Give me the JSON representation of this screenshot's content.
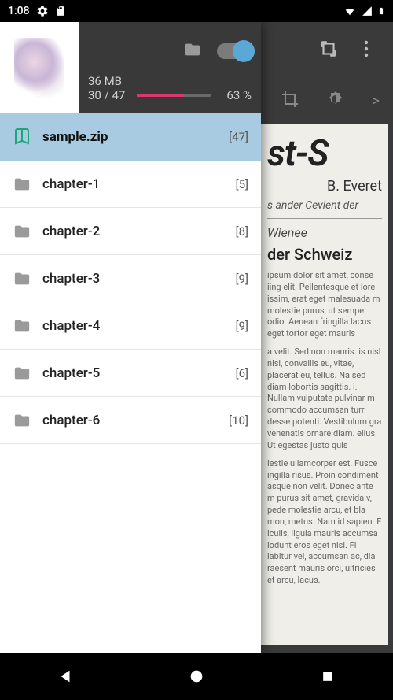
{
  "status": {
    "time": "1:08"
  },
  "drawer": {
    "size": "36 MB",
    "progress": {
      "fraction": "30 / 47",
      "percent": "63 %",
      "fill": 63
    }
  },
  "list": {
    "items": [
      {
        "label": "sample.zip",
        "count": "[47]",
        "type": "book",
        "selected": true
      },
      {
        "label": "chapter-1",
        "count": "[5]",
        "type": "folder",
        "selected": false
      },
      {
        "label": "chapter-2",
        "count": "[8]",
        "type": "folder",
        "selected": false
      },
      {
        "label": "chapter-3",
        "count": "[9]",
        "type": "folder",
        "selected": false
      },
      {
        "label": "chapter-4",
        "count": "[9]",
        "type": "folder",
        "selected": false
      },
      {
        "label": "chapter-5",
        "count": "[6]",
        "type": "folder",
        "selected": false
      },
      {
        "label": "chapter-6",
        "count": "[10]",
        "type": "folder",
        "selected": false
      }
    ]
  },
  "doc": {
    "title_frag": "st-S",
    "author": "B. Everet",
    "subtitle": "s ander Cevient der",
    "section1": "Wienee",
    "section2": "der Schweiz",
    "para1": "ipsum dolor sit amet, conse iing elit. Pellentesque et lore issim, erat eget malesuada m molestie purus, ut sempe odio. Aenean fringilla lacus eget tortor eget mauris",
    "para2": "a velit. Sed non mauris. is nisl nisl, convallis eu, vitae, placerat eu, tellus. Na sed diam lobortis sagittis. i. Nullam vulputate pulvinar m commodo accumsan turr desse potenti. Vestibulum gra venenatis ornare diam. ellus. Ut egestas justo quis",
    "para3": "lestie ullamcorper est. Fusce ingilla risus. Proin condiment asque non velit. Donec ante m purus sit amet, gravida v, pede molestie arcu, et bla mon, metus. Nam id sapien. F iculis, ligula mauris accumsa iodunt eros eget nisl. Fi labitur vel, accumsan ac, dia raesent mauris orci, ultricies et arcu, lacus."
  }
}
